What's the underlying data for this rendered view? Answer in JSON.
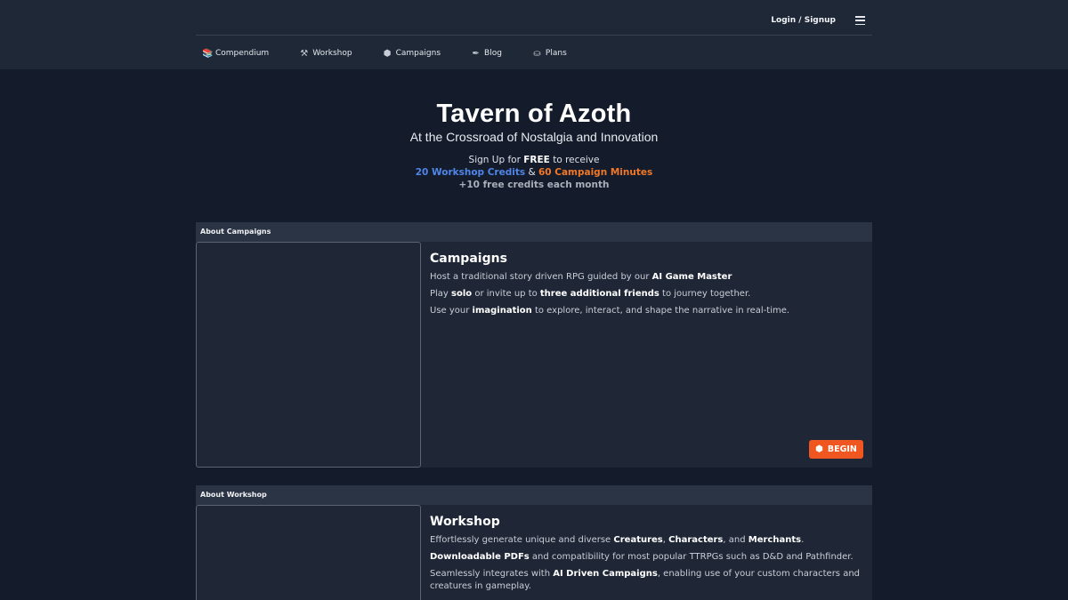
{
  "header": {
    "login_label": "Login / Signup",
    "menu_icon": "hamburger-icon",
    "nav": [
      {
        "label": "Compendium",
        "icon": "books-icon",
        "glyph": "📚"
      },
      {
        "label": "Workshop",
        "icon": "hammer-icon",
        "glyph": "⚒"
      },
      {
        "label": "Campaigns",
        "icon": "d20-icon",
        "glyph": "⬢"
      },
      {
        "label": "Blog",
        "icon": "quill-icon",
        "glyph": "✒"
      },
      {
        "label": "Plans",
        "icon": "coins-icon",
        "glyph": "⛀"
      }
    ]
  },
  "hero": {
    "title": "Tavern of Azoth",
    "subtitle": "At the Crossroad of Nostalgia and Innovation",
    "signup_prefix": "Sign Up for ",
    "signup_free": "FREE",
    "signup_suffix": " to receive",
    "workshop_credits": "20 Workshop Credits",
    "amp": " & ",
    "campaign_minutes": "60 Campaign Minutes",
    "monthly": "+10 free credits each month"
  },
  "campaigns_card": {
    "header": "About Campaigns",
    "title": "Campaigns",
    "lines": [
      [
        {
          "t": "Host a traditional story driven RPG guided by our "
        },
        {
          "t": "AI Game Master",
          "b": true
        }
      ],
      [
        {
          "t": "Play "
        },
        {
          "t": "solo",
          "b": true
        },
        {
          "t": " or invite up to "
        },
        {
          "t": "three additional friends",
          "b": true
        },
        {
          "t": " to journey together."
        }
      ],
      [
        {
          "t": "Use your "
        },
        {
          "t": "imagination",
          "b": true
        },
        {
          "t": " to explore, interact, and shape the narrative in real-time."
        }
      ]
    ],
    "button_label": "BEGIN",
    "button_icon": "d20-icon"
  },
  "workshop_card": {
    "header": "About Workshop",
    "title": "Workshop",
    "lines": [
      [
        {
          "t": "Effortlessly generate unique and diverse "
        },
        {
          "t": "Creatures",
          "b": true
        },
        {
          "t": ", "
        },
        {
          "t": "Characters",
          "b": true
        },
        {
          "t": ", and "
        },
        {
          "t": "Merchants",
          "b": true
        },
        {
          "t": "."
        }
      ],
      [
        {
          "t": "Downloadable PDFs",
          "b": true
        },
        {
          "t": " and compatibility for most popular TTRPGs such as D&D and Pathfinder."
        }
      ],
      [
        {
          "t": "Seamlessly integrates with "
        },
        {
          "t": "AI Driven Campaigns",
          "b": true
        },
        {
          "t": ", enabling use of your custom characters and creatures in gameplay."
        }
      ]
    ]
  },
  "colors": {
    "background": "#141b2a",
    "topbar": "#1f2837",
    "card": "#1f2737",
    "accent_blue": "#4f86e8",
    "accent_orange": "#f07828",
    "button": "#f0561f"
  }
}
